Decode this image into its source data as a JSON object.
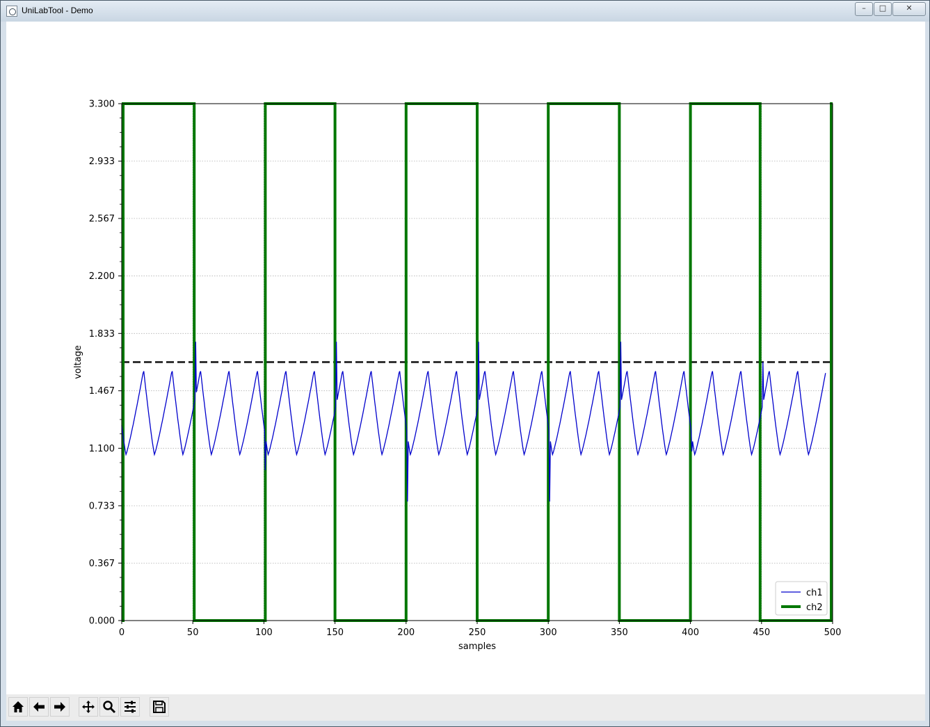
{
  "window": {
    "title": "UniLabTool - Demo",
    "controls": [
      "minimize",
      "maximize",
      "close"
    ]
  },
  "toolbar": {
    "buttons": [
      {
        "name": "home-button",
        "icon": "home-icon"
      },
      {
        "name": "back-button",
        "icon": "arrow-left-icon"
      },
      {
        "name": "forward-button",
        "icon": "arrow-right-icon"
      },
      {
        "name": "pan-button",
        "icon": "move-icon"
      },
      {
        "name": "zoom-button",
        "icon": "magnifier-icon"
      },
      {
        "name": "configure-subplots-button",
        "icon": "sliders-icon"
      },
      {
        "name": "save-button",
        "icon": "floppy-disk-icon"
      }
    ]
  },
  "chart_data": {
    "type": "line",
    "xlabel": "samples",
    "ylabel": "voltage",
    "xlim": [
      0,
      500
    ],
    "ylim": [
      0,
      3.3
    ],
    "x_ticks": [
      "0",
      "50",
      "100",
      "150",
      "200",
      "250",
      "300",
      "350",
      "400",
      "450",
      "500"
    ],
    "y_ticks": [
      "0.000",
      "0.367",
      "0.733",
      "1.100",
      "1.467",
      "1.833",
      "2.200",
      "2.567",
      "2.933",
      "3.300"
    ],
    "grid": true,
    "legend_position": "lower-right",
    "trigger_level": 1.65,
    "trigger_sample": 250,
    "series": [
      {
        "name": "ch1",
        "color": "#0000cc",
        "style": "thin",
        "waveform": "triangle-like",
        "period_samples": 20,
        "min": 1.06,
        "max": 1.6,
        "glitches": [
          {
            "x": 52,
            "y": 1.78
          },
          {
            "x": 101,
            "y": 0.96
          },
          {
            "x": 151,
            "y": 1.78
          },
          {
            "x": 201,
            "y": 0.76
          },
          {
            "x": 251,
            "y": 1.78
          },
          {
            "x": 301,
            "y": 0.76
          },
          {
            "x": 351,
            "y": 1.78
          },
          {
            "x": 401,
            "y": 1.08
          },
          {
            "x": 451,
            "y": 1.65
          }
        ]
      },
      {
        "name": "ch2",
        "color": "#007700",
        "style": "thick",
        "waveform": "square",
        "low": 0.0,
        "high": 3.3,
        "edges": [
          1,
          51,
          101,
          150,
          200,
          250,
          300,
          350,
          400,
          449,
          499
        ]
      }
    ],
    "reference_lines": [
      {
        "orientation": "horizontal",
        "value": 1.65,
        "style": "dashed",
        "color": "#333333"
      },
      {
        "orientation": "vertical",
        "value": 250,
        "style": "dashed",
        "color": "#333333"
      }
    ]
  }
}
